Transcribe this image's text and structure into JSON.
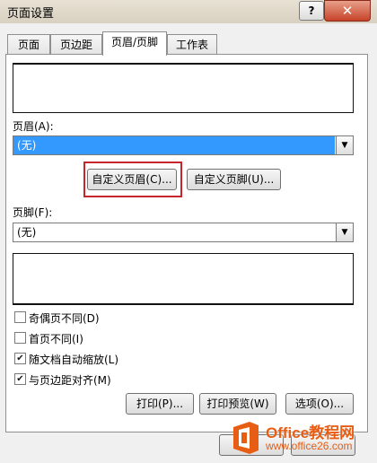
{
  "window": {
    "title": "页面设置",
    "help": "?",
    "close": "✕"
  },
  "tabs": [
    {
      "label": "页面",
      "active": false
    },
    {
      "label": "页边距",
      "active": false
    },
    {
      "label": "页眉/页脚",
      "active": true
    },
    {
      "label": "工作表",
      "active": false
    }
  ],
  "header": {
    "label": "页眉(A):",
    "value": "(无)",
    "custom_button": "自定义页眉(C)...",
    "custom_footer_button": "自定义页脚(U)..."
  },
  "footer": {
    "label": "页脚(F):",
    "value": "(无)"
  },
  "options": [
    {
      "label": "奇偶页不同(D)",
      "checked": false
    },
    {
      "label": "首页不同(I)",
      "checked": false
    },
    {
      "label": "随文档自动缩放(L)",
      "checked": true
    },
    {
      "label": "与页边距对齐(M)",
      "checked": true
    }
  ],
  "actions": {
    "print": "打印(P)...",
    "print_preview": "打印预览(W)",
    "options": "选项(O)..."
  },
  "watermark": {
    "title": "Office教程网",
    "subtitle": "www.office26.com"
  },
  "icons": {
    "arrow": "triangle-down-icon",
    "check": "check-icon",
    "logo": "office-logo-icon"
  }
}
